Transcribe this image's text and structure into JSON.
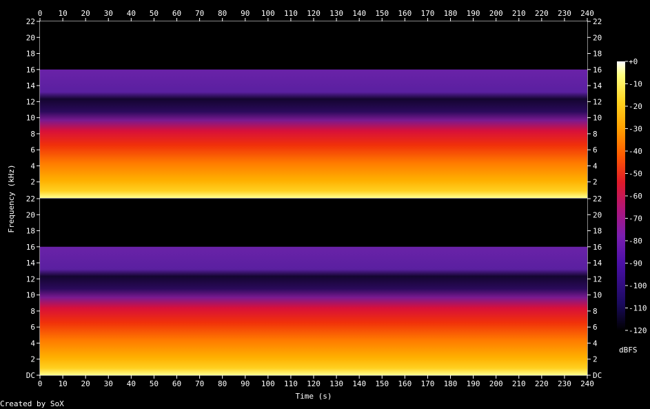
{
  "chart_data": {
    "type": "heatmap",
    "subtype": "spectrogram",
    "xlabel": "Time (s)",
    "ylabel": "Frequency (kHz)",
    "xlim": [
      0,
      240
    ],
    "ylim": [
      0,
      22
    ],
    "x_ticks": [
      "0",
      "10",
      "20",
      "30",
      "40",
      "50",
      "60",
      "70",
      "80",
      "90",
      "100",
      "110",
      "120",
      "130",
      "140",
      "150",
      "160",
      "170",
      "180",
      "190",
      "200",
      "210",
      "220",
      "230",
      "240"
    ],
    "channels": [
      {
        "y_ticks": [
          "22",
          "20",
          "18",
          "16",
          "14",
          "12",
          "10",
          "8",
          "6",
          "4",
          "2"
        ],
        "bands": [
          {
            "from_khz": 16,
            "to_khz": 22,
            "dbfs": -120
          },
          {
            "from_khz": 13,
            "to_khz": 16,
            "dbfs": -85
          },
          {
            "from_khz": 10.5,
            "to_khz": 13,
            "dbfs": -100
          },
          {
            "from_khz": 8.5,
            "to_khz": 10.5,
            "dbfs": -75
          },
          {
            "from_khz": 5,
            "to_khz": 8.5,
            "dbfs": -60
          },
          {
            "from_khz": 2,
            "to_khz": 5,
            "dbfs": -45
          },
          {
            "from_khz": 0,
            "to_khz": 2,
            "dbfs": -30
          }
        ]
      },
      {
        "y_ticks": [
          "22",
          "20",
          "18",
          "16",
          "14",
          "12",
          "10",
          "8",
          "6",
          "4",
          "2",
          "DC"
        ],
        "bands": [
          {
            "from_khz": 16,
            "to_khz": 22,
            "dbfs": -120
          },
          {
            "from_khz": 13,
            "to_khz": 16,
            "dbfs": -85
          },
          {
            "from_khz": 10.5,
            "to_khz": 13,
            "dbfs": -100
          },
          {
            "from_khz": 8.5,
            "to_khz": 10.5,
            "dbfs": -75
          },
          {
            "from_khz": 5,
            "to_khz": 8.5,
            "dbfs": -60
          },
          {
            "from_khz": 2,
            "to_khz": 5,
            "dbfs": -45
          },
          {
            "from_khz": 0,
            "to_khz": 2,
            "dbfs": -30
          }
        ]
      }
    ],
    "colorbar": {
      "label": "dBFS",
      "ticks": [
        "+0",
        "-10",
        "-20",
        "-30",
        "-40",
        "-50",
        "-60",
        "-70",
        "-80",
        "-90",
        "-100",
        "-110",
        "-120"
      ],
      "range_dbfs": [
        -120,
        0
      ],
      "colors": [
        "#000000",
        "#1a0a5e",
        "#4b0fa8",
        "#7a1eb0",
        "#b0157a",
        "#e01a2a",
        "#ff5a00",
        "#ffa000",
        "#ffd420",
        "#ffff80",
        "#ffffff"
      ]
    }
  },
  "footer": {
    "credit": "Created by SoX"
  }
}
